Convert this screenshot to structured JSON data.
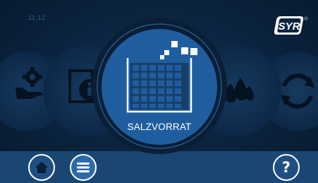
{
  "status": {
    "time": "11:12"
  },
  "brand": {
    "logo_text": "SYR"
  },
  "carousel": {
    "items": [
      {
        "name": "gear-hand",
        "icon": "gear-hand-icon"
      },
      {
        "name": "info",
        "icon": "info-icon"
      },
      {
        "name": "salzvorrat",
        "icon": "salt-supply-icon",
        "label": "SALZVORRAT",
        "selected": true
      },
      {
        "name": "water",
        "icon": "water-drops-icon"
      },
      {
        "name": "refresh",
        "icon": "refresh-icon"
      }
    ]
  },
  "navigation": {
    "home": {
      "icon": "home-icon"
    },
    "menu": {
      "icon": "menu-icon",
      "active": true
    },
    "help": {
      "icon": "help-icon",
      "label": "?"
    }
  },
  "colors": {
    "background": "#0b2440",
    "selected_item": "#1f5e9e",
    "bottom_bar": "#1a4673",
    "dim_icon": "#16375a",
    "white": "#ffffff"
  }
}
